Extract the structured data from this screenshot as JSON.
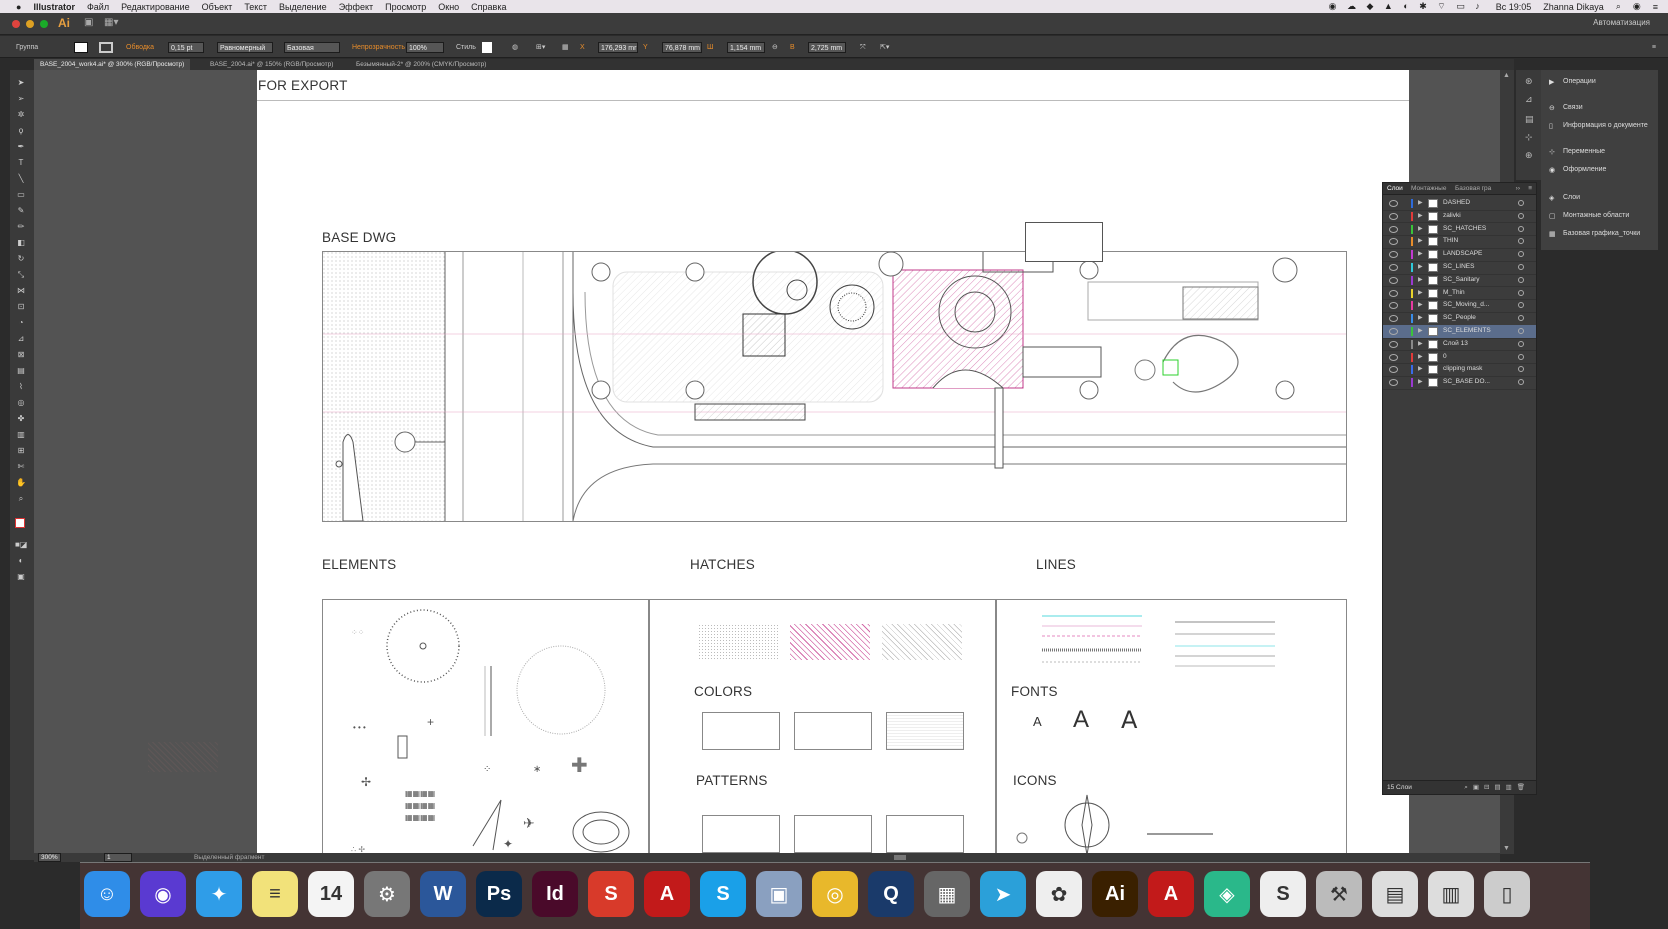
{
  "menubar": {
    "app": "Illustrator",
    "items": [
      "Файл",
      "Редактирование",
      "Объект",
      "Текст",
      "Выделение",
      "Эффект",
      "Просмотр",
      "Окно",
      "Справка"
    ],
    "clock": "Вс 19:05",
    "user": "Zhanna Dikaya"
  },
  "titlebar": {
    "app_badge": "Ai",
    "workspace": "Автоматизация"
  },
  "control": {
    "selection": "Группа",
    "stroke_label": "Обводка",
    "stroke_value": "0,15 pt",
    "profile": "Равномерный",
    "brush": "Базовая",
    "opacity_label": "Непрозрачность",
    "opacity_value": "100%",
    "style_label": "Стиль",
    "x_label": "X",
    "x_value": "176,293 mr",
    "y_label": "Y",
    "y_value": "76,878 mm",
    "w_label": "Ш",
    "w_value": "1,154 mm",
    "h_label": "В",
    "h_value": "2,725 mm"
  },
  "tabs": [
    {
      "label": "BASE_2004_work4.ai* @ 300% (RGB/Просмотр)"
    },
    {
      "label": "BASE_2004.ai* @ 150% (RGB/Просмотр)"
    },
    {
      "label": "Безымянный-2* @ 200% (CMYK/Просмотр)"
    }
  ],
  "artboard": {
    "title": "FOR EXPORT",
    "base": "BASE DWG",
    "elements": "ELEMENTS",
    "hatches": "HATCHES",
    "lines": "LINES",
    "colors": "COLORS",
    "fonts": "FONTS",
    "patterns": "PATTERNS",
    "icons": "ICONS",
    "font_sample": "A"
  },
  "status": {
    "zoom": "300%",
    "page": "1",
    "info": "Выделенный фрагмент"
  },
  "right_panel": {
    "items": [
      "Операции",
      "Связи",
      "Информация о документе",
      "Переменные",
      "Оформление"
    ],
    "items2": [
      "Слои",
      "Монтажные области",
      "Базовая графика_точки"
    ]
  },
  "layers": {
    "tabs": [
      "Слои",
      "Монтажные",
      "Базовая гра"
    ],
    "rows": [
      {
        "name": "DASHED",
        "color": "#2f6bd9"
      },
      {
        "name": "zalivki",
        "color": "#e23a3a"
      },
      {
        "name": "SC_HATCHES",
        "color": "#3ac43a"
      },
      {
        "name": "THIN",
        "color": "#e88d2b"
      },
      {
        "name": "LANDSCAPE",
        "color": "#c23ad1"
      },
      {
        "name": "SC_LINES",
        "color": "#2fc8d9"
      },
      {
        "name": "SC_Sanitary",
        "color": "#9a3ad1"
      },
      {
        "name": "M_Thin",
        "color": "#e8d32b"
      },
      {
        "name": "SC_Moving_d...",
        "color": "#e83aa0"
      },
      {
        "name": "SC_People",
        "color": "#3a8de8"
      },
      {
        "name": "SC_ELEMENTS",
        "color": "#3ac43a"
      },
      {
        "name": "Слой 13",
        "color": "#8a8a8a"
      },
      {
        "name": "0",
        "color": "#e23a3a"
      },
      {
        "name": "clipping mask",
        "color": "#3a6be8"
      },
      {
        "name": "SC_BASE DO...",
        "color": "#9a3ad1"
      }
    ],
    "count": "15 Слои"
  },
  "dock": [
    {
      "name": "finder-icon",
      "glyph": "☺",
      "color": "#2f8de8"
    },
    {
      "name": "siri-icon",
      "glyph": "◉",
      "color": "#5a3ad1"
    },
    {
      "name": "safari-icon",
      "glyph": "✦",
      "color": "#2f9de8"
    },
    {
      "name": "notes-icon",
      "glyph": "≡",
      "color": "#f2e27a"
    },
    {
      "name": "calendar-icon",
      "glyph": "14",
      "color": "#f4f4f4"
    },
    {
      "name": "system-preferences-icon",
      "glyph": "⚙",
      "color": "#777"
    },
    {
      "name": "word-icon",
      "glyph": "W",
      "color": "#2b579a"
    },
    {
      "name": "photoshop-icon",
      "glyph": "Ps",
      "color": "#0b2a4a"
    },
    {
      "name": "indesign-icon",
      "glyph": "Id",
      "color": "#4a0a2a"
    },
    {
      "name": "sketchup-icon",
      "glyph": "S",
      "color": "#d83a2a"
    },
    {
      "name": "autocad-icon",
      "glyph": "A",
      "color": "#c21a1a"
    },
    {
      "name": "skype-icon",
      "glyph": "S",
      "color": "#1aa0e8"
    },
    {
      "name": "preview-icon",
      "glyph": "▣",
      "color": "#8aa0c0"
    },
    {
      "name": "chrome-icon",
      "glyph": "◎",
      "color": "#e8b82b"
    },
    {
      "name": "quicktime-icon",
      "glyph": "Q",
      "color": "#1a3a6a"
    },
    {
      "name": "calculator-icon",
      "glyph": "▦",
      "color": "#666"
    },
    {
      "name": "telegram-icon",
      "glyph": "➤",
      "color": "#2ba0d9"
    },
    {
      "name": "photos-icon",
      "glyph": "✿",
      "color": "#eee"
    },
    {
      "name": "illustrator-icon",
      "glyph": "Ai",
      "color": "#3a2000"
    },
    {
      "name": "acrobat-icon",
      "glyph": "A",
      "color": "#c21a1a"
    },
    {
      "name": "vpn-icon",
      "glyph": "◈",
      "color": "#2ab88a"
    },
    {
      "name": "sketchbook-icon",
      "glyph": "S",
      "color": "#eee"
    },
    {
      "name": "utility-icon",
      "glyph": "⚒",
      "color": "#bbb"
    },
    {
      "name": "documents-folder-icon",
      "glyph": "▤",
      "color": "#ddd"
    },
    {
      "name": "downloads-folder-icon",
      "glyph": "▥",
      "color": "#ddd"
    },
    {
      "name": "trash-icon",
      "glyph": "▯",
      "color": "#ccc"
    }
  ]
}
